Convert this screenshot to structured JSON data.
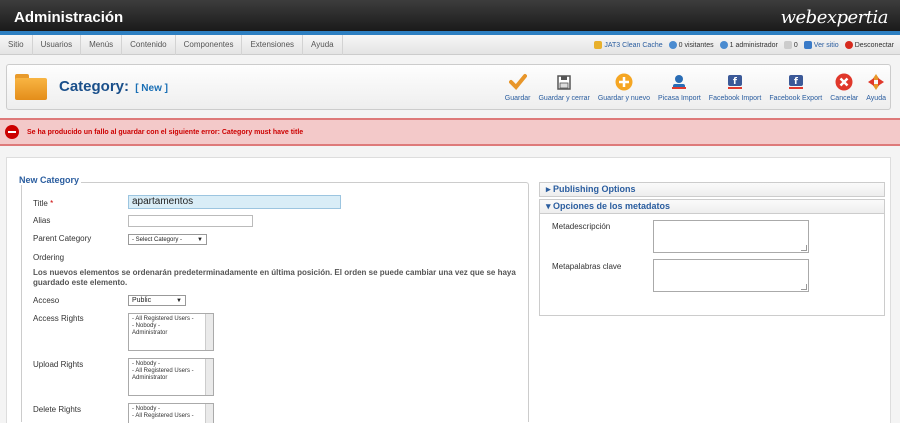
{
  "header": {
    "title": "Administración",
    "brand": "webexpertia"
  },
  "menu": [
    "Sitio",
    "Usuarios",
    "Menús",
    "Contenido",
    "Componentes",
    "Extensiones",
    "Ayuda"
  ],
  "status": {
    "cache": "JAT3 Clean Cache",
    "visitors": "0 visitantes",
    "admins": "1 administrador",
    "messages": "0",
    "view_site": "Ver sitio",
    "logout": "Desconectar"
  },
  "toolbar": {
    "title": "Category:",
    "title_sub": "[ New ]",
    "buttons": [
      "Guardar",
      "Guardar y cerrar",
      "Guardar y nuevo",
      "Picasa Import",
      "Facebook Import",
      "Facebook Export",
      "Cancelar",
      "Ayuda"
    ]
  },
  "error": {
    "message": "Se ha producido un fallo al guardar con el siguiente error: Category must have title"
  },
  "form": {
    "legend": "New Category",
    "title_label": "Title",
    "required_mark": "*",
    "title_value": "apartamentos",
    "alias_label": "Alias",
    "alias_value": "",
    "parent_label": "Parent Category",
    "parent_value": "- Select Category -",
    "ordering_label": "Ordering",
    "ordering_note": "Los nuevos elementos se ordenarán predeterminadamente en última posición. El orden se puede cambiar una vez que se haya guardado este elemento.",
    "access_label": "Acceso",
    "access_value": "Public",
    "access_rights_label": "Access Rights",
    "access_rights_options": [
      "- All Registered Users -",
      "- Nobody -",
      "Administrator"
    ],
    "upload_rights_label": "Upload Rights",
    "upload_rights_options": [
      "- Nobody -",
      "- All Registered Users -",
      "Administrator"
    ],
    "delete_rights_label": "Delete Rights",
    "delete_rights_options": [
      "- Nobody -",
      "- All Registered Users -"
    ]
  },
  "panels": {
    "publishing": "Publishing Options",
    "metadata": "Opciones de los metadatos",
    "meta_desc_label": "Metadescripción",
    "meta_keywords_label": "Metapalabras clave"
  },
  "colors": {
    "accent": "#2d7fc1",
    "error": "#cc0000",
    "link": "#2a5d9f"
  }
}
